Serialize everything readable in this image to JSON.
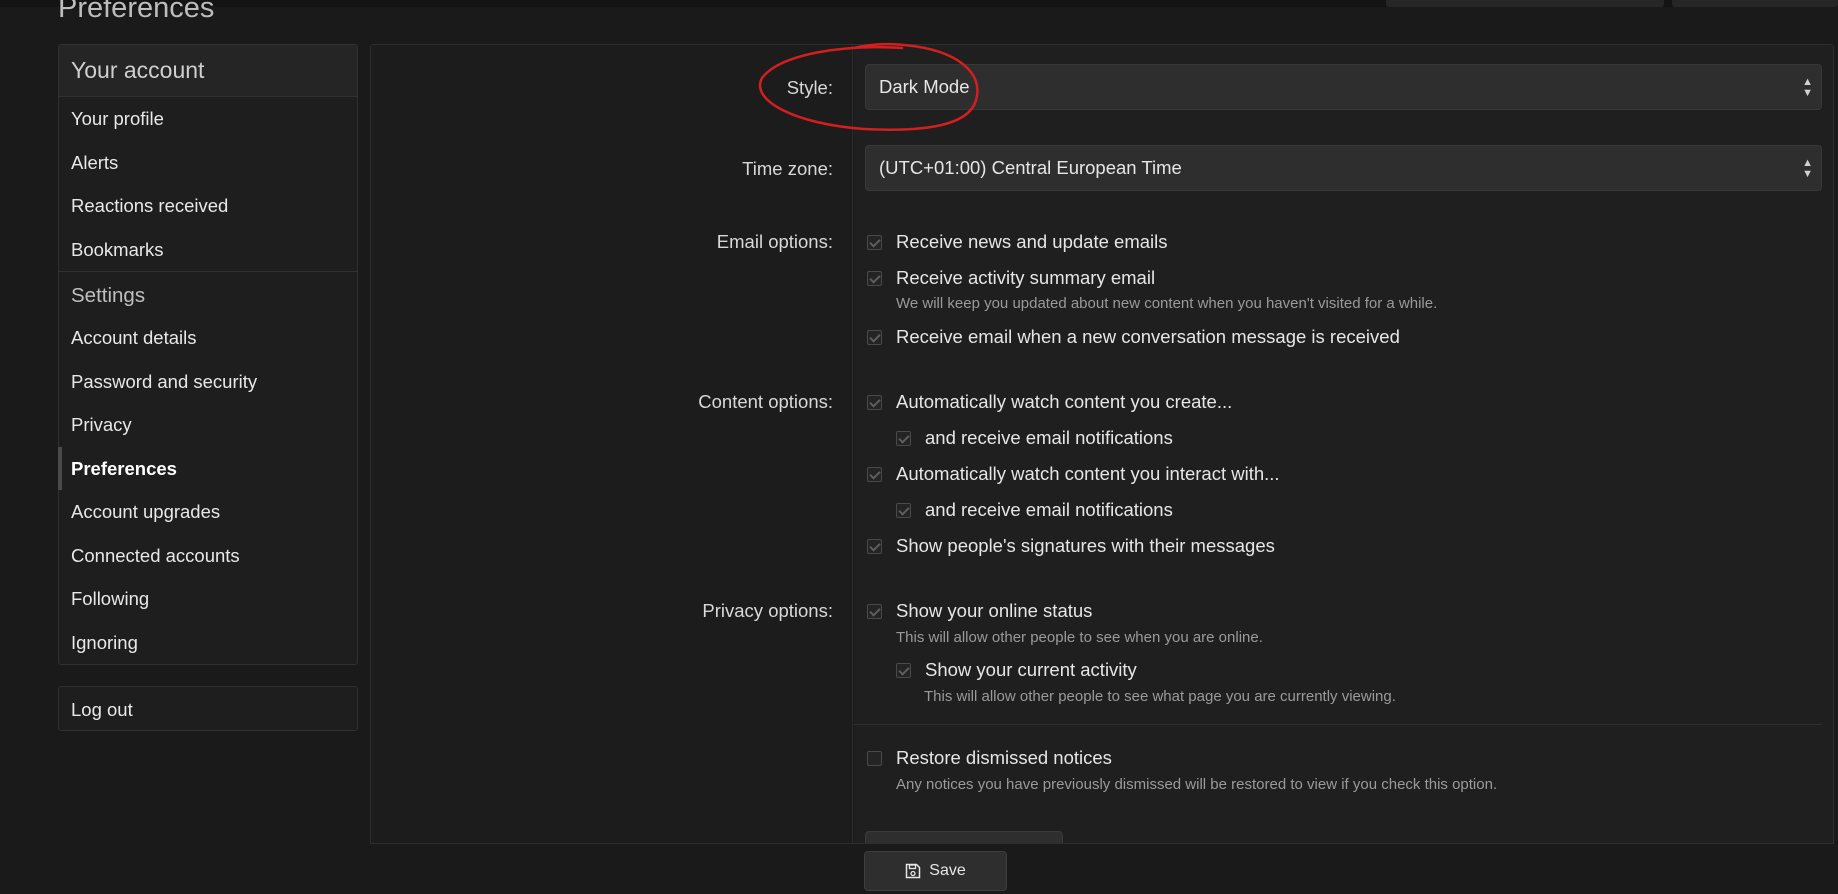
{
  "page": {
    "title": "Preferences"
  },
  "sidebar": {
    "header": "Your account",
    "account_items": [
      {
        "label": "Your profile"
      },
      {
        "label": "Alerts"
      },
      {
        "label": "Reactions received"
      },
      {
        "label": "Bookmarks"
      }
    ],
    "settings_header": "Settings",
    "settings_items": [
      {
        "label": "Account details"
      },
      {
        "label": "Password and security"
      },
      {
        "label": "Privacy"
      },
      {
        "label": "Preferences",
        "active": true
      },
      {
        "label": "Account upgrades"
      },
      {
        "label": "Connected accounts"
      },
      {
        "label": "Following"
      },
      {
        "label": "Ignoring"
      }
    ],
    "logout": "Log out"
  },
  "form": {
    "style": {
      "label": "Style:",
      "value": "Dark Mode"
    },
    "timezone": {
      "label": "Time zone:",
      "value": "(UTC+01:00) Central European Time"
    },
    "email": {
      "label": "Email options:",
      "news": "Receive news and update emails",
      "summary": "Receive activity summary email",
      "summary_hint": "We will keep you updated about new content when you haven't visited for a while.",
      "conversation": "Receive email when a new conversation message is received"
    },
    "content": {
      "label": "Content options:",
      "watch_create": "Automatically watch content you create...",
      "watch_create_email": "and receive email notifications",
      "watch_interact": "Automatically watch content you interact with...",
      "watch_interact_email": "and receive email notifications",
      "signatures": "Show people's signatures with their messages"
    },
    "privacy": {
      "label": "Privacy options:",
      "online": "Show your online status",
      "online_hint": "This will allow other people to see when you are online.",
      "activity": "Show your current activity",
      "activity_hint": "This will allow other people to see what page you are currently viewing."
    },
    "restore": {
      "label": "Restore dismissed notices",
      "hint": "Any notices you have previously dismissed will be restored to view if you check this option."
    }
  },
  "footer": {
    "save": "Save"
  },
  "colors": {
    "annotation": "#d21f1f"
  }
}
